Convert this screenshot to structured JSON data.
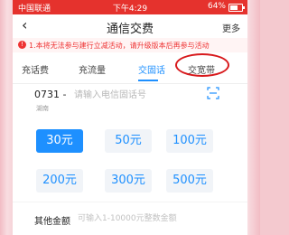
{
  "status_bar": {
    "carrier": "中国联通",
    "time": "下午4:29",
    "battery": "64%"
  },
  "nav": {
    "title": "通信交费",
    "more": "更多"
  },
  "notice": {
    "text": "1.本将无法参与建行立减活动，请升级版本后再参与活动"
  },
  "tabs": [
    {
      "label": "充话费",
      "active": false
    },
    {
      "label": "充流量",
      "active": false
    },
    {
      "label": "交固话",
      "active": true
    },
    {
      "label": "交宽带",
      "active": false
    }
  ],
  "phone": {
    "area_code": "0731",
    "separator": "-",
    "placeholder": "请输入电信固话号",
    "province": "湖南"
  },
  "amounts": [
    {
      "label": "30元",
      "selected": true
    },
    {
      "label": "50元",
      "selected": false
    },
    {
      "label": "100元",
      "selected": false
    },
    {
      "label": "200元",
      "selected": false
    },
    {
      "label": "300元",
      "selected": false
    },
    {
      "label": "500元",
      "selected": false
    }
  ],
  "other": {
    "label": "其他金额",
    "placeholder": "可输入1-10000元整数金额"
  },
  "colors": {
    "status_bar": "#e5322d",
    "accent": "#1e90ff",
    "annotation": "#d8191c"
  }
}
